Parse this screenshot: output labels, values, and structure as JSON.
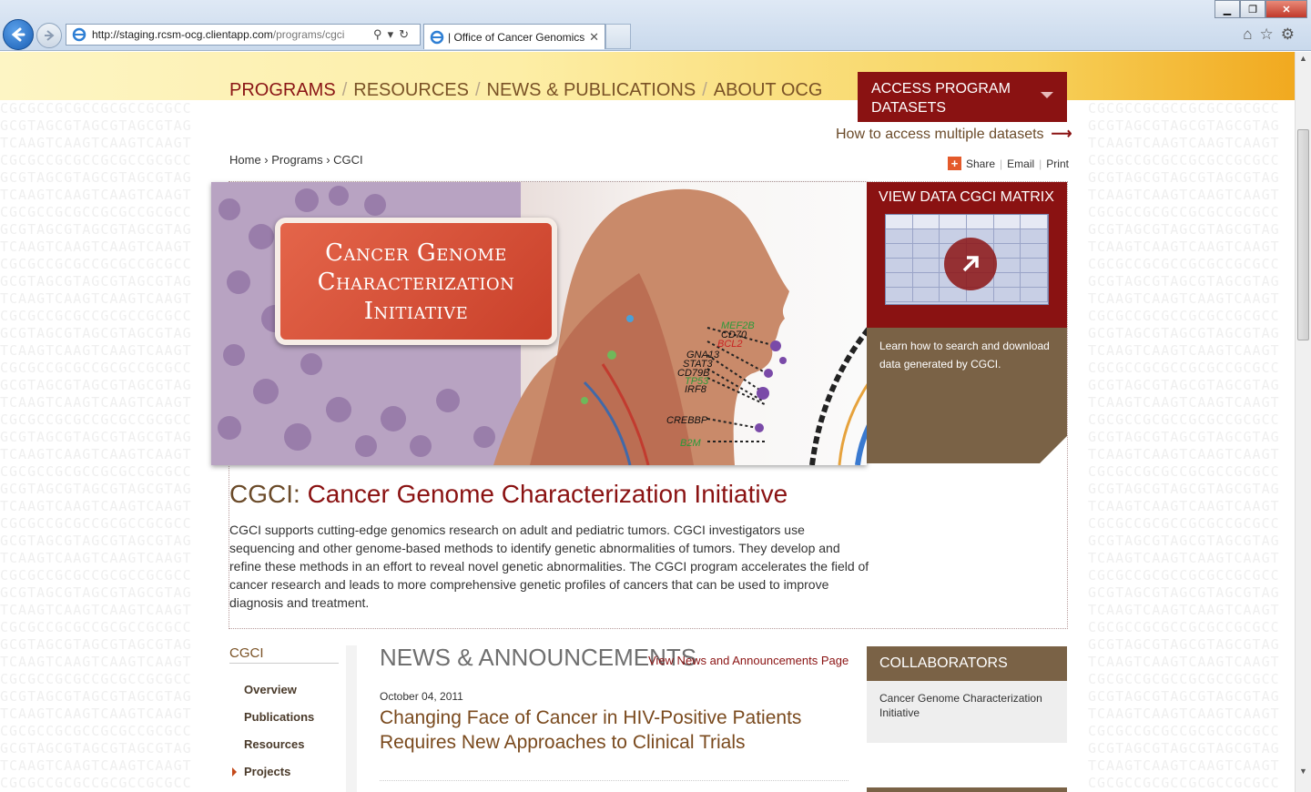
{
  "browser": {
    "url_host": "http://staging.rcsm-ocg.clientapp.com",
    "url_path": "/programs/cgci",
    "tab_title": "| Office of Cancer Genomics"
  },
  "nav": {
    "items": [
      "PROGRAMS",
      "RESOURCES",
      "NEWS & PUBLICATIONS",
      "ABOUT OCG"
    ],
    "separator": "/"
  },
  "access": {
    "label_line1": "ACCESS PROGRAM",
    "label_line2": "DATASETS",
    "howto": "How to access multiple datasets"
  },
  "breadcrumb": "Home › Programs › CGCI",
  "share": {
    "share": "Share",
    "email": "Email",
    "print": "Print"
  },
  "hero": {
    "plate_line1": "Cancer Genome",
    "plate_line2": "Characterization",
    "plate_line3": "Initiative",
    "genes": [
      "MEF2B",
      "CD70",
      "BCL2",
      "GNA13",
      "STAT3",
      "CD79B",
      "TP53",
      "IRF8",
      "CREBBP",
      "B2M"
    ]
  },
  "matrix": {
    "title": "VIEW DATA CGCI MATRIX",
    "description": "Learn how to search and download data generated by CGCI."
  },
  "program": {
    "abbr": "CGCI:",
    "full_name": "Cancer Genome Characterization Initiative",
    "body": "CGCI supports cutting-edge genomics research on adult and pediatric tumors. CGCI investigators use sequencing and other genome-based methods to identify genetic abnormalities of tumors. They develop and refine these methods in an effort to reveal novel genetic abnormalities. The CGCI program accelerates the field of cancer research and leads to more comprehensive genetic profiles of cancers that can be used to improve diagnosis and treatment."
  },
  "sidebar": {
    "heading": "CGCI",
    "items": [
      "Overview",
      "Publications",
      "Resources",
      "Projects"
    ]
  },
  "news": {
    "heading": "NEWS & ANNOUNCEMENTS",
    "page_link": "View News and Announcements Page",
    "date": "October 04, 2011",
    "title": "Changing Face of Cancer in HIV-Positive Patients Requires New Approaches to Clinical Trials"
  },
  "collaborators": {
    "heading": "COLLABORATORS",
    "body": "Cancer Genome Characterization Initiative"
  },
  "colors": {
    "brand_red": "#8a1212",
    "brand_brown": "#7a6246",
    "header_gold": "#f1a91f"
  }
}
